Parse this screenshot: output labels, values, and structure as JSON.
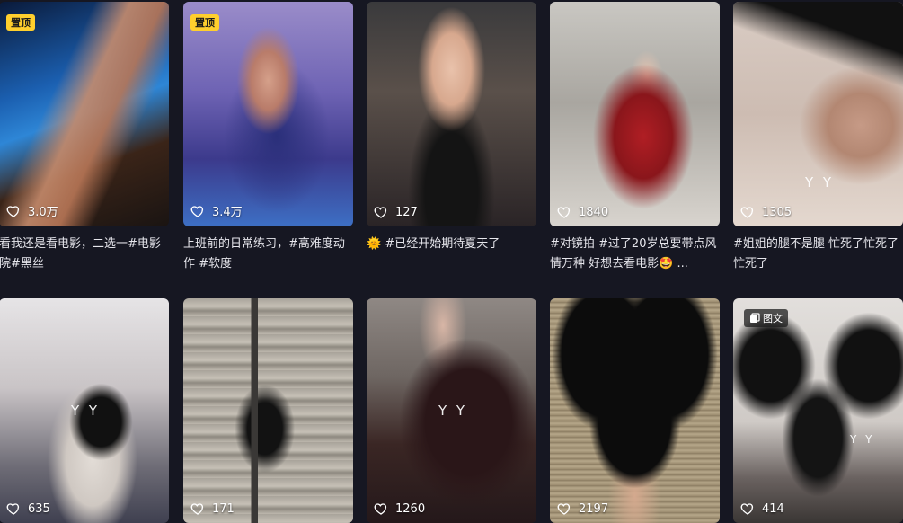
{
  "row1": [
    {
      "likes": "3.0万",
      "caption": "看我还是看电影，二选一#电影院#黑丝",
      "pinned": "置顶"
    },
    {
      "likes": "3.4万",
      "caption": "上班前的日常练习，#高难度动作 #软度",
      "pinned": "置顶"
    },
    {
      "likes": "127",
      "caption": "🌞 #已经开始期待夏天了"
    },
    {
      "likes": "1840",
      "caption": "#对镜拍 #过了20岁总要带点风情万种 好想去看电影🤩 ..."
    },
    {
      "likes": "1305",
      "caption": "#姐姐的腿不是腿 忙死了忙死了忙死了",
      "watermark": "Y Y"
    }
  ],
  "row2": [
    {
      "likes": "635",
      "watermark": "Y Y"
    },
    {
      "likes": "171"
    },
    {
      "likes": "1260",
      "watermark": "Y Y"
    },
    {
      "likes": "2197"
    },
    {
      "likes": "414",
      "badge": "图文",
      "watermark": "Y Y"
    }
  ],
  "colors": {
    "background": "#161722",
    "pin_badge": "#ffcf2d"
  },
  "icons": {
    "like": "heart-outline-icon",
    "gallery": "gallery-icon"
  }
}
